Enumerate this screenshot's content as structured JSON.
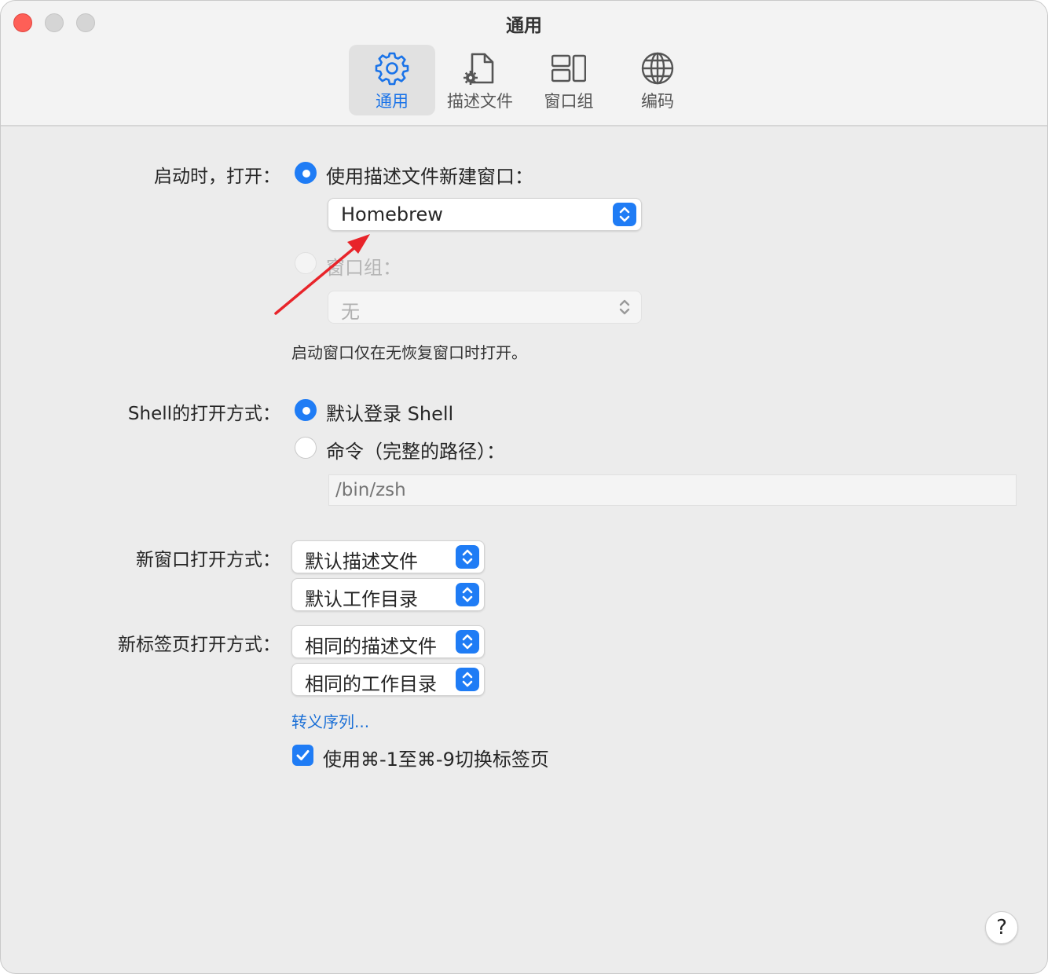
{
  "window": {
    "title": "通用"
  },
  "toolbar": {
    "items": [
      {
        "label": "通用",
        "icon": "gear-icon",
        "active": true
      },
      {
        "label": "描述文件",
        "icon": "profile-document-icon",
        "active": false
      },
      {
        "label": "窗口组",
        "icon": "window-group-icon",
        "active": false
      },
      {
        "label": "编码",
        "icon": "globe-icon",
        "active": false
      }
    ]
  },
  "startup": {
    "label": "启动时，打开：",
    "option_profile": "使用描述文件新建窗口：",
    "profile_value": "Homebrew",
    "option_group": "窗口组：",
    "group_value": "无",
    "note": "启动窗口仅在无恢复窗口时打开。"
  },
  "shell": {
    "label": "Shell的打开方式：",
    "option_default": "默认登录 Shell",
    "option_command": "命令（完整的路径）：",
    "command_placeholder": "/bin/zsh"
  },
  "new_window": {
    "label": "新窗口打开方式：",
    "profile_value": "默认描述文件",
    "directory_value": "默认工作目录"
  },
  "new_tab": {
    "label": "新标签页打开方式：",
    "profile_value": "相同的描述文件",
    "directory_value": "相同的工作目录"
  },
  "escape_link": "转义序列...",
  "tab_switch": {
    "label": "使用⌘-1至⌘-9切换标签页",
    "checked": true
  },
  "help_label": "?",
  "colors": {
    "accent": "#1f7cf5",
    "close": "#fe5f57",
    "annotation_arrow": "#e8242a"
  }
}
